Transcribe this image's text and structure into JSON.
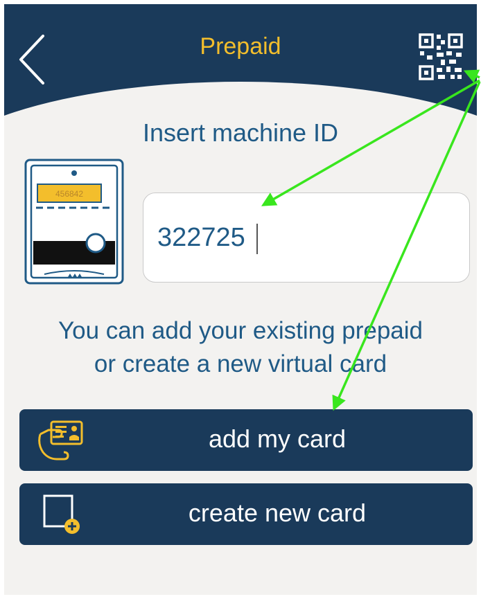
{
  "header": {
    "title": "Prepaid",
    "back_icon": "chevron-left-icon",
    "qr_icon": "qr-code-icon"
  },
  "machine": {
    "label": "Insert machine ID",
    "illustration_id_text": "456842",
    "id_value": "322725"
  },
  "info": {
    "line1": "You can add your existing prepaid",
    "line2": "or create a new virtual card"
  },
  "buttons": {
    "add_card": {
      "label": "add my card",
      "icon": "hand-card-icon"
    },
    "create_card": {
      "label": "create new card",
      "icon": "card-plus-icon"
    }
  },
  "colors": {
    "header_bg": "#1a3a5a",
    "title": "#f3be2c",
    "text_blue": "#1f5a86",
    "annotation_green": "#39e61e",
    "background": "#f3f2f0"
  }
}
